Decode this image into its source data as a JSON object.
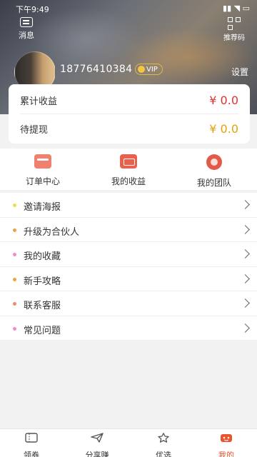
{
  "status_bar": {
    "time": "下午9:49",
    "system": "▮▮ ◥ ▭"
  },
  "header": {
    "messages_label": "消息",
    "recommend_code_label": "推荐码",
    "phone": "18776410384",
    "vip_label": "VIP",
    "settings_label": "设置"
  },
  "earnings": {
    "total_label": "累计收益",
    "total_value": "¥ 0.0",
    "total_color": "#e0322c",
    "pending_label": "待提现",
    "pending_value": "¥ 0.0",
    "pending_color": "#e3a20a"
  },
  "quick_actions": [
    {
      "label": "订单中心",
      "icon": "order-card-icon"
    },
    {
      "label": "我的收益",
      "icon": "wallet-icon"
    },
    {
      "label": "我的团队",
      "icon": "team-icon"
    }
  ],
  "menu": [
    {
      "label": "邀请海报",
      "dot_color": "#e8e04a"
    },
    {
      "label": "升级为合伙人",
      "dot_color": "#f0a040"
    },
    {
      "label": "我的收藏",
      "dot_color": "#f08ad0"
    },
    {
      "label": "新手攻略",
      "dot_color": "#f0a040"
    },
    {
      "label": "联系客服",
      "dot_color": "#f08a70"
    },
    {
      "label": "常见问题",
      "dot_color": "#f08ad0"
    }
  ],
  "tabs": [
    {
      "label": "领券",
      "icon": "coupon-icon",
      "active": false
    },
    {
      "label": "分享赚",
      "icon": "share-plane-icon",
      "active": false
    },
    {
      "label": "优选",
      "icon": "star-icon",
      "active": false
    },
    {
      "label": "我的",
      "icon": "profile-icon",
      "active": true
    }
  ],
  "accent_color": "#e9542f"
}
